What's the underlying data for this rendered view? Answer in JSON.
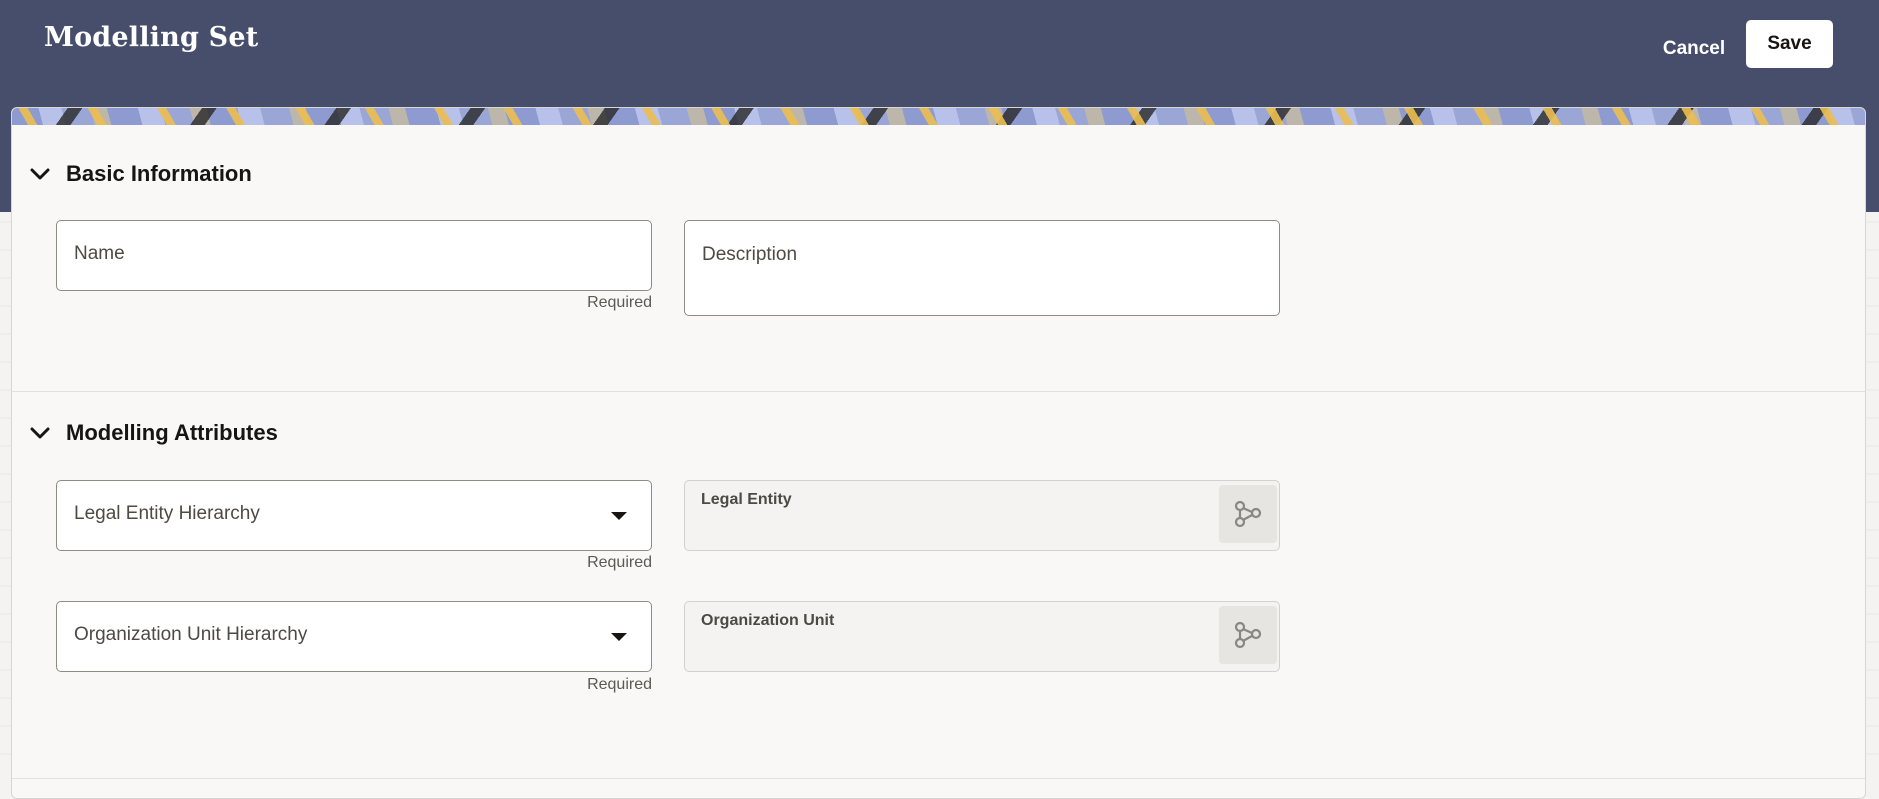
{
  "header": {
    "title": "Modelling Set",
    "cancel_label": "Cancel",
    "save_label": "Save"
  },
  "sections": [
    {
      "title": "Basic Information",
      "icon": "chevron-down-icon",
      "fields": {
        "name": {
          "label": "Name",
          "value": "",
          "helper": "Required"
        },
        "description": {
          "label": "Description",
          "value": ""
        }
      }
    },
    {
      "title": "Modelling Attributes",
      "icon": "chevron-down-icon",
      "fields": {
        "legal_entity_hierarchy": {
          "label": "Legal Entity Hierarchy",
          "value": "",
          "helper": "Required"
        },
        "legal_entity": {
          "label": "Legal Entity",
          "value": "",
          "icon": "hierarchy-tree-icon"
        },
        "org_unit_hierarchy": {
          "label": "Organization Unit Hierarchy",
          "value": "",
          "helper": "Required"
        },
        "org_unit": {
          "label": "Organization Unit",
          "value": "",
          "icon": "hierarchy-tree-icon"
        }
      }
    }
  ],
  "colors": {
    "header_bg": "#474e6b",
    "page_bg": "#f4f3f1",
    "card_bg": "#f9f8f6",
    "text": "#161513"
  }
}
